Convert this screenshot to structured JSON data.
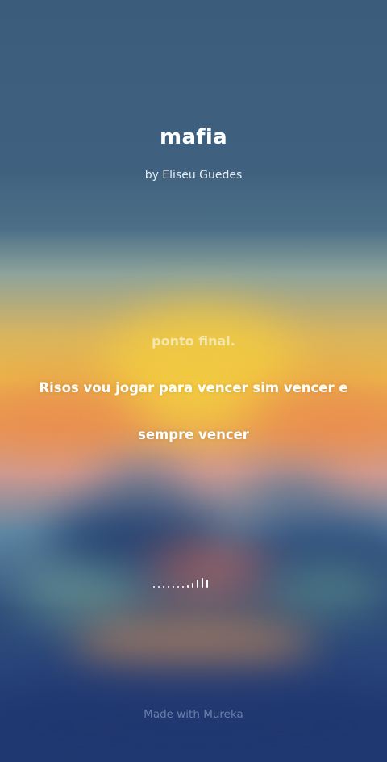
{
  "song": {
    "title": "mafia",
    "artist": "by Eliseu Guedes"
  },
  "lyrics": {
    "previous": "ponto final.",
    "current": "Risos vou jogar para vencer sim vencer e sempre vencer"
  },
  "visualizer": {
    "levels": [
      0.15,
      0.15,
      0.15,
      0.15,
      0.15,
      0.15,
      0.15,
      0.2,
      0.45,
      0.7,
      0.85,
      0.7
    ]
  },
  "footer": {
    "watermark": "Made with Mureka"
  },
  "colors": {
    "sky_top": "#3c5c7b",
    "sun_glow": "#ecba48",
    "horizon_orange": "#e79a5a",
    "deep_blue": "#213a72"
  }
}
